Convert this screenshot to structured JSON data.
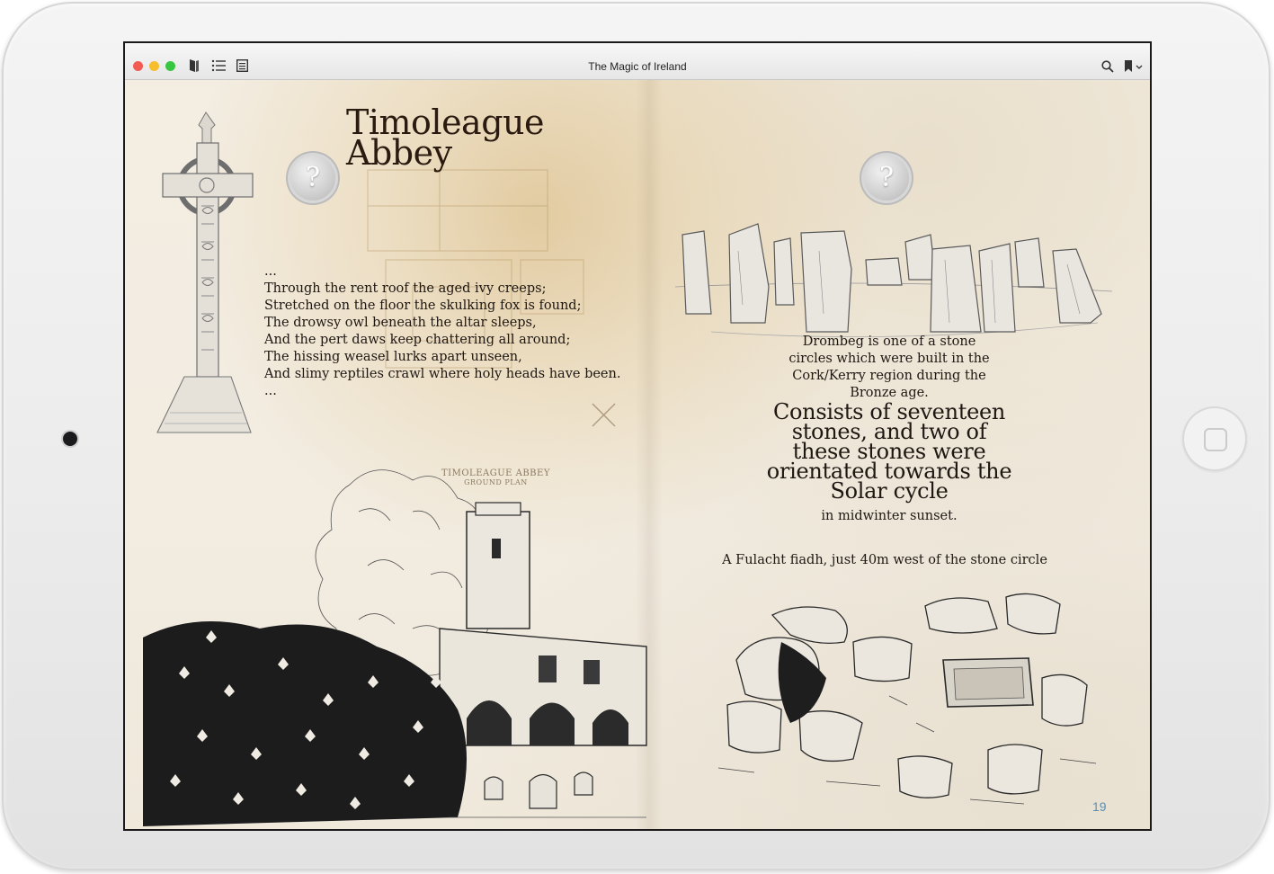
{
  "window": {
    "title": "The Magic of Ireland"
  },
  "toolbar": {
    "icons": [
      "book-icon",
      "list-icon",
      "document-icon",
      "search-icon",
      "bookmark-icon",
      "chevron-down-icon"
    ]
  },
  "left_page": {
    "title_line1": "Timoleague",
    "title_line2": "Abbey",
    "poem": [
      "...",
      "Through the rent roof the aged ivy creeps;",
      "Stretched on the floor the skulking fox is found;",
      "The drowsy owl beneath the altar sleeps,",
      "And the pert daws keep chattering all around;",
      "The hissing weasel lurks apart unseen,",
      "And slimy reptiles crawl where holy heads have been.",
      "..."
    ],
    "plan_label_line1": "TIMOLEAGUE ABBEY",
    "plan_label_line2": "GROUND PLAN"
  },
  "right_page": {
    "intro_lines": [
      "Drombeg is one of a stone",
      "circles which were built in the",
      "Cork/Kerry region during the",
      "Bronze age."
    ],
    "highlight_lines": [
      "Consists of seventeen",
      "stones, and two of",
      "these stones were",
      "orientated towards the",
      "Solar cycle"
    ],
    "after_line": "in midwinter sunset.",
    "caption": "A Fulacht fiadh, just 40m west of the stone circle",
    "page_number": "19"
  },
  "badge": {
    "glyph": "?"
  },
  "colors": {
    "paper": "#f2ece1",
    "ink": "#1e1712",
    "page_number": "#5a8fb0",
    "frame": "#ececec"
  }
}
